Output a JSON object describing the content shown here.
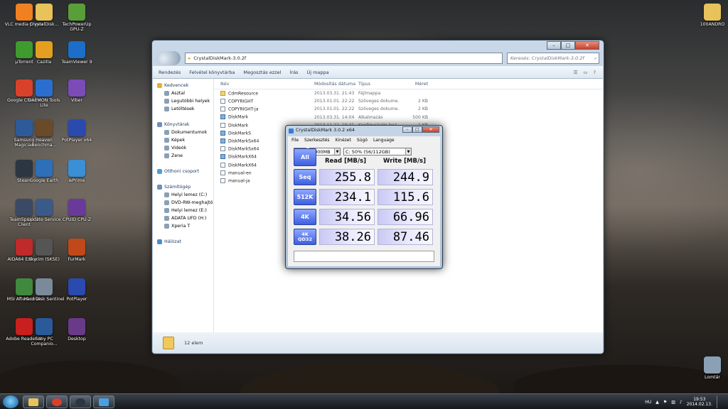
{
  "desktop_icons": [
    {
      "label": "VLC media player",
      "icon": "vlc-icon",
      "color": "#f08020"
    },
    {
      "label": "CrystalDisk...",
      "icon": "folder-icon",
      "color": "#e8c25a"
    },
    {
      "label": "TechPowerUp GPU-Z",
      "icon": "gpuz-icon",
      "color": "#5a9e3a"
    },
    {
      "label": "µTorrent",
      "icon": "utorrent-icon",
      "color": "#3f9b2f"
    },
    {
      "label": "Cazilla",
      "icon": "cazilla-icon",
      "color": "#e3a020"
    },
    {
      "label": "TeamViewer 9",
      "icon": "teamviewer-icon",
      "color": "#1c6ec8"
    },
    {
      "label": "Google Chrome",
      "icon": "chrome-icon",
      "color": "#d9412b"
    },
    {
      "label": "DAEMON Tools Lite",
      "icon": "daemon-tools-icon",
      "color": "#2a6fcf"
    },
    {
      "label": "Viber",
      "icon": "viber-icon",
      "color": "#7b4bb8"
    },
    {
      "label": "Samsung Magician",
      "icon": "samsung-magician-icon",
      "color": "#2e5a9a"
    },
    {
      "label": "Heaven Benchma...",
      "icon": "heaven-icon",
      "color": "#6b4a2a"
    },
    {
      "label": "PotPlayer x64",
      "icon": "potplayer-icon",
      "color": "#2a4ab0"
    },
    {
      "label": "Steam",
      "icon": "steam-icon",
      "color": "#2b3642"
    },
    {
      "label": "Google Earth",
      "icon": "google-earth-icon",
      "color": "#2d6fb8"
    },
    {
      "label": "wPrime",
      "icon": "wprime-icon",
      "color": "#3a8fd6"
    },
    {
      "label": "TeamSpeak 3 Client",
      "icon": "teamspeak-icon",
      "color": "#3a4a66"
    },
    {
      "label": "Update Service",
      "icon": "update-service-icon",
      "color": "#3a5a8a"
    },
    {
      "label": "CPUID CPU-Z",
      "icon": "cpuz-icon",
      "color": "#6a3a9a"
    },
    {
      "label": "AIDA64 Extre...",
      "icon": "aida64-icon",
      "color": "#c02a2a"
    },
    {
      "label": "Skyrim (SKSE)",
      "icon": "skyrim-icon",
      "color": "#555555"
    },
    {
      "label": "FurMark",
      "icon": "furmark-icon",
      "color": "#c0481a"
    },
    {
      "label": "MSI Afterburner",
      "icon": "msi-afterburner-icon",
      "color": "#3f8a3f"
    },
    {
      "label": "Hard Disk Sentinel",
      "icon": "hdsentinel-icon",
      "color": "#7a8a9a"
    },
    {
      "label": "PotPlayer",
      "icon": "potplayer-icon",
      "color": "#2a4ab0"
    },
    {
      "label": "Adobe Reader XI",
      "icon": "adobe-reader-icon",
      "color": "#c8201e"
    },
    {
      "label": "Sony PC Companio...",
      "icon": "sony-pc-companion-icon",
      "color": "#2a5a9a"
    },
    {
      "label": "Desktop",
      "icon": "winrar-icon",
      "color": "#6a3a8a"
    },
    {
      "label": "100ANDRO",
      "icon": "folder-icon",
      "color": "#e8c25a"
    },
    {
      "label": "Lomtár",
      "icon": "recycle-bin-icon",
      "color": "#8aa0b5"
    }
  ],
  "explorer": {
    "address": "CrystalDiskMark-3.0.2f",
    "search_placeholder": "Keresés: CrystalDiskMark-3.0.2f",
    "toolbar": [
      "Rendezés",
      "Felvétel könyvtárba",
      "Megosztás ezzel",
      "Írás",
      "Új mappa"
    ],
    "nav": [
      {
        "label": "Kedvencek",
        "icon": "star-icon",
        "level": 0
      },
      {
        "label": "Asztal",
        "icon": "desktop-icon",
        "level": 1
      },
      {
        "label": "Legutóbbi helyek",
        "icon": "recent-places-icon",
        "level": 1
      },
      {
        "label": "Letöltések",
        "icon": "downloads-icon",
        "level": 1
      },
      {
        "label": "",
        "icon": "",
        "level": -1
      },
      {
        "label": "Könyvtárak",
        "icon": "libraries-icon",
        "level": 0
      },
      {
        "label": "Dokumentumok",
        "icon": "documents-icon",
        "level": 1
      },
      {
        "label": "Képek",
        "icon": "pictures-icon",
        "level": 1
      },
      {
        "label": "Videók",
        "icon": "videos-icon",
        "level": 1
      },
      {
        "label": "Zene",
        "icon": "music-icon",
        "level": 1
      },
      {
        "label": "",
        "icon": "",
        "level": -1
      },
      {
        "label": "Otthoni csoport",
        "icon": "homegroup-icon",
        "level": 0
      },
      {
        "label": "",
        "icon": "",
        "level": -1
      },
      {
        "label": "Számítógép",
        "icon": "computer-icon",
        "level": 0
      },
      {
        "label": "Helyi lemez (C:)",
        "icon": "drive-icon",
        "level": 1
      },
      {
        "label": "DVD-RW-meghajtó",
        "icon": "dvd-icon",
        "level": 1
      },
      {
        "label": "Helyi lemez (E:)",
        "icon": "drive-icon",
        "level": 1
      },
      {
        "label": "ADATA UFD (H:)",
        "icon": "usb-drive-icon",
        "level": 1
      },
      {
        "label": "Xperia T",
        "icon": "phone-icon",
        "level": 1
      },
      {
        "label": "",
        "icon": "",
        "level": -1
      },
      {
        "label": "Hálózat",
        "icon": "network-icon",
        "level": 0
      }
    ],
    "columns": {
      "name": "Név",
      "date": "Módosítás dátuma",
      "type": "Típus",
      "size": "Méret"
    },
    "files": [
      {
        "name": "CdmResource",
        "date": "2013.03.31. 21:43",
        "type": "Fájlmappa",
        "size": "",
        "kind": "folder"
      },
      {
        "name": "COPYRIGHT",
        "date": "2013.01.01. 22:22",
        "type": "Szöveges dokume...",
        "size": "2 KB",
        "kind": "doc"
      },
      {
        "name": "COPYRIGHT-ja",
        "date": "2013.01.01. 22:22",
        "type": "Szöveges dokume...",
        "size": "2 KB",
        "kind": "doc"
      },
      {
        "name": "DiskMark",
        "date": "2013.03.31. 14:04",
        "type": "Alkalmazás",
        "size": "500 KB",
        "kind": "app"
      },
      {
        "name": "DiskMark",
        "date": "2013.11.22. 19:31",
        "type": "Konfigurációs beá...",
        "size": "1 KB",
        "kind": "doc"
      },
      {
        "name": "DiskMarkS",
        "date": "",
        "type": "",
        "size": "",
        "kind": "app"
      },
      {
        "name": "DiskMarkSx64",
        "date": "",
        "type": "",
        "size": "",
        "kind": "app"
      },
      {
        "name": "DiskMarkSx64",
        "date": "",
        "type": "",
        "size": "",
        "kind": "doc"
      },
      {
        "name": "DiskMarkX64",
        "date": "",
        "type": "",
        "size": "",
        "kind": "app"
      },
      {
        "name": "DiskMarkX64",
        "date": "",
        "type": "",
        "size": "",
        "kind": "doc"
      },
      {
        "name": "manual-en",
        "date": "",
        "type": "",
        "size": "",
        "kind": "doc"
      },
      {
        "name": "manual-ja",
        "date": "",
        "type": "",
        "size": "",
        "kind": "doc"
      }
    ],
    "status": "12 elem"
  },
  "cdm": {
    "title": "CrystalDiskMark 3.0.2 x64",
    "menu": [
      "File",
      "Szerkesztés",
      "Kinézet",
      "Súgó",
      "Language"
    ],
    "count": "5",
    "size": "1000MB",
    "drive": "C: 50% (56/112GB)",
    "read_header": "Read [MB/s]",
    "write_header": "Write [MB/s]",
    "all_label": "All",
    "rows": [
      {
        "label": "Seq",
        "label2": "",
        "read": "255.8",
        "write": "244.9"
      },
      {
        "label": "512K",
        "label2": "",
        "read": "234.1",
        "write": "115.6"
      },
      {
        "label": "4K",
        "label2": "",
        "read": "34.56",
        "write": "66.96"
      },
      {
        "label": "4K",
        "label2": "QD32",
        "read": "38.26",
        "write": "87.46"
      }
    ],
    "colors": {
      "button": "#3e5ee0",
      "value_bg": "#c9c9f4"
    }
  },
  "taskbar": {
    "lang": "HU",
    "time": "19:53",
    "date": "2014.02.13."
  }
}
